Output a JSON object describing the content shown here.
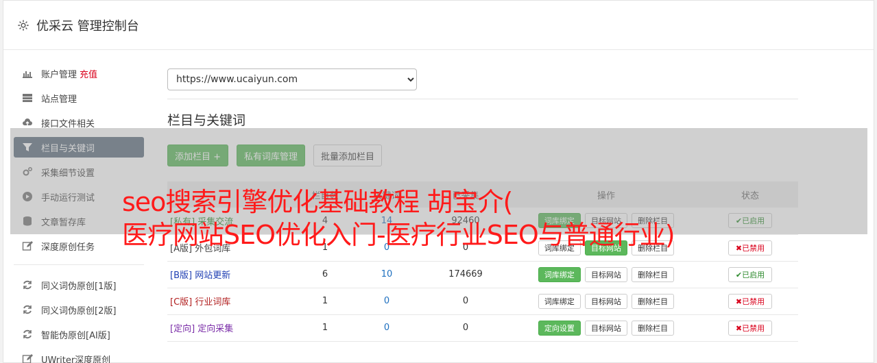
{
  "header": {
    "title": "优采云 管理控制台",
    "icon": "gear-icon"
  },
  "sidebar": {
    "items": [
      {
        "label": "账户管理",
        "extra": "充值",
        "icon": "bar-chart-icon"
      },
      {
        "label": "站点管理",
        "icon": "server-icon"
      },
      {
        "label": "接口文件相关",
        "icon": "cloud-upload-icon"
      },
      {
        "label": "栏目与关键词",
        "icon": "filter-icon",
        "active": true
      },
      {
        "label": "采集细节设置",
        "icon": "gears-icon"
      },
      {
        "label": "手动运行测试",
        "icon": "play-circle-icon"
      },
      {
        "label": "文章暂存库",
        "icon": "database-icon"
      },
      {
        "label": "深度原创任务",
        "icon": "edit-icon"
      }
    ],
    "items2": [
      {
        "label": "同义词伪原创[1版]",
        "icon": "refresh-icon"
      },
      {
        "label": "同义词伪原创[2版]",
        "icon": "refresh-icon"
      },
      {
        "label": "智能伪原创[AI版]",
        "icon": "refresh-icon"
      },
      {
        "label": "UWriter深度原创",
        "icon": "edit-icon"
      }
    ]
  },
  "main": {
    "site_select": "https://www.ucaiyun.com",
    "section_title": "栏目与关键词",
    "buttons": {
      "add_column": "添加栏目 +",
      "private_lib": "私有词库管理",
      "batch_add": "批量添加栏目"
    }
  },
  "table": {
    "headers": [
      "",
      "栏目数",
      "关键词",
      "已采集",
      "操作",
      "状态"
    ],
    "rows": [
      {
        "tag": "[私有]",
        "name": "采集交流",
        "tag_class": "tag-private",
        "c1": "4",
        "c2": "14",
        "c3": "92460",
        "bind": "词库绑定",
        "bind_green": true,
        "site": "目标网站",
        "del": "删除栏目",
        "status": "✔已启用",
        "on": true
      },
      {
        "tag": "[A版]",
        "name": "外包词库",
        "tag_class": "tag-a",
        "c1": "1",
        "c2": "0",
        "c3": "0",
        "bind": "词库绑定",
        "bind_green": false,
        "site": "目标网站",
        "del": "删除栏目",
        "status": "✖已禁用",
        "on": false
      },
      {
        "tag": "[B版]",
        "name": "网站更新",
        "tag_class": "tag-b",
        "c1": "6",
        "c2": "10",
        "c3": "174669",
        "bind": "词库绑定",
        "bind_green": true,
        "site": "目标网站",
        "del": "删除栏目",
        "status": "✔已启用",
        "on": true
      },
      {
        "tag": "[C版]",
        "name": "行业词库",
        "tag_class": "tag-c",
        "c1": "1",
        "c2": "0",
        "c3": "0",
        "bind": "词库绑定",
        "bind_green": false,
        "site": "目标网站",
        "del": "删除栏目",
        "status": "✖已禁用",
        "on": false
      },
      {
        "tag": "[定向]",
        "name": "定向采集",
        "tag_class": "tag-dir",
        "c1": "1",
        "c2": "0",
        "c3": "0",
        "bind": "定向设置",
        "bind_green": true,
        "site": "目标网站",
        "del": "删除栏目",
        "status": "✖已禁用",
        "on": false
      }
    ]
  },
  "overlay": {
    "line1": "seo搜索引擎优化基础教程 胡宝介(",
    "line2": "医疗网站SEO优化入门-医疗行业SEO与普通行业)"
  },
  "colors": {
    "accent": "#5cb85c",
    "active_sidebar": "#5f6f80",
    "overlay_text": "#ff1a1a"
  }
}
